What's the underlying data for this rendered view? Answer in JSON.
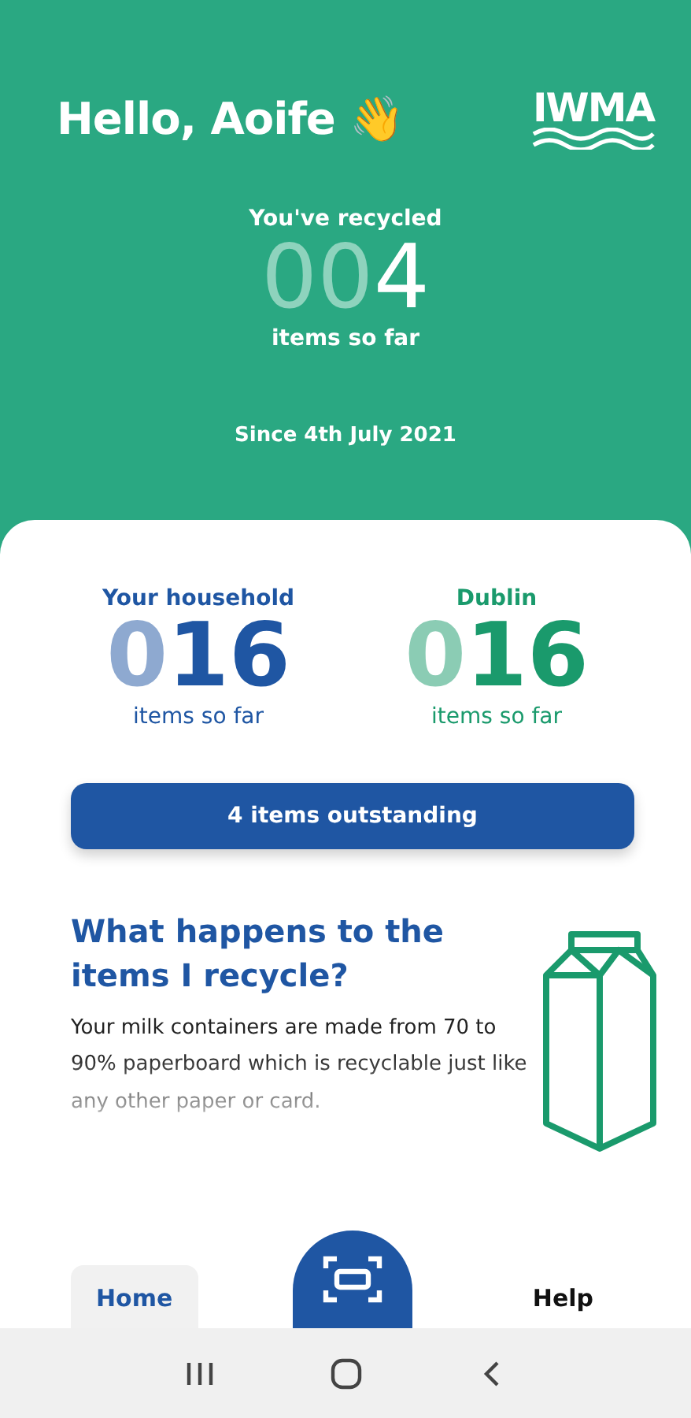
{
  "header": {
    "greeting": "Hello, Aoife 👋",
    "logo": "IWMA",
    "recycled_label": "You've recycled",
    "count": "004",
    "count_caption": "items so far",
    "since": "Since 4th July 2021"
  },
  "stats": [
    {
      "label": "Your household",
      "count": "016",
      "caption": "items so far",
      "color": "#1f56a3"
    },
    {
      "label": "Dublin",
      "count": "016",
      "caption": "items so far",
      "color": "#1a9a6c"
    }
  ],
  "outstanding_button": "4 items outstanding",
  "info": {
    "title": "What happens to the items I recycle?",
    "body": "Your milk containers are made from 70 to 90% paperboard which is recyclable just like any other paper or card."
  },
  "nav": [
    {
      "label": "Home",
      "selected": true
    },
    {
      "label": "Help",
      "selected": false
    }
  ]
}
